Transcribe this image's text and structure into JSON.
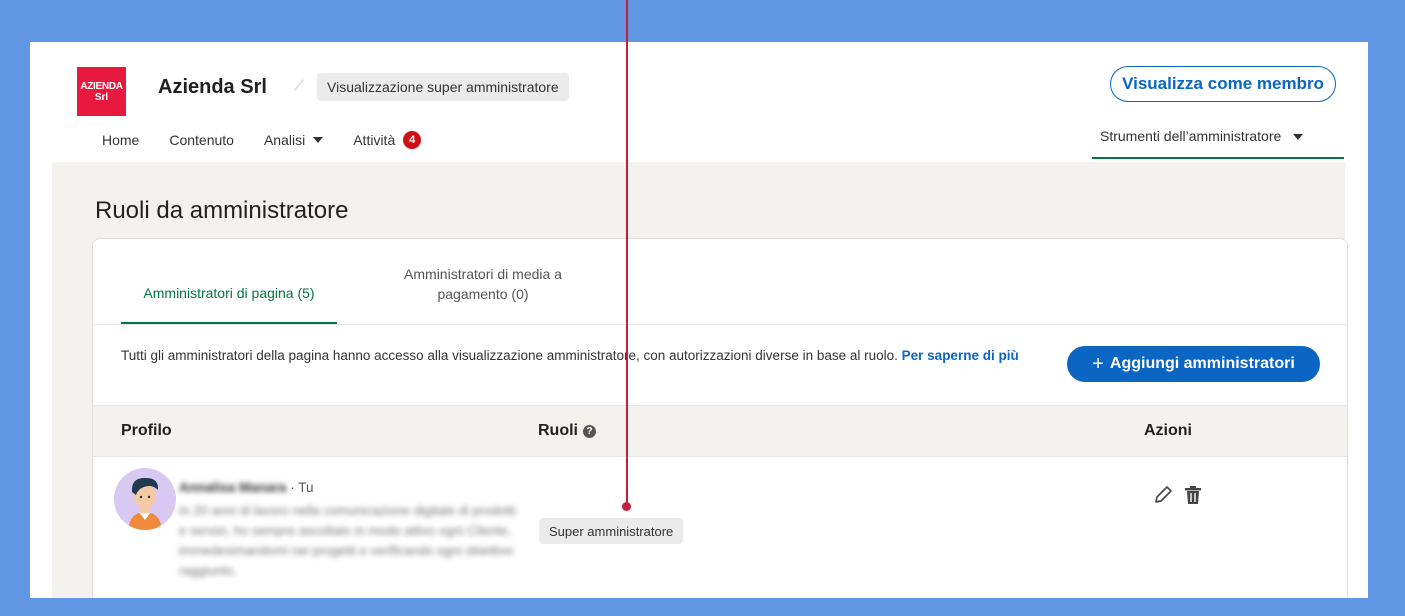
{
  "app": {
    "logo": {
      "line1": "AZIENDA",
      "line2": "Srl"
    },
    "company_name": "Azienda Srl",
    "view_badge": "Visualizzazione super amministratore",
    "view_as_member": "Visualizza come membro"
  },
  "nav": {
    "items": [
      {
        "label": "Home"
      },
      {
        "label": "Contenuto"
      },
      {
        "label": "Analisi"
      },
      {
        "label": "Attività",
        "badge": "4"
      }
    ],
    "admin_tools": "Strumenti dell’amministratore"
  },
  "page": {
    "title": "Ruoli da amministratore",
    "tabs": [
      {
        "label": "Amministratori di pagina (5)",
        "active": true
      },
      {
        "label": "Amministratori di media a pagamento (0)",
        "active": false
      }
    ],
    "info_text": "Tutti gli amministratori della pagina hanno accesso alla visualizzazione amministratore, con autorizzazioni diverse in base al ruolo.",
    "info_link": "Per saperne di più",
    "add_button": "Aggiungi amministratori"
  },
  "table": {
    "headers": {
      "profile": "Profilo",
      "roles": "Ruoli",
      "actions": "Azioni"
    },
    "rows": [
      {
        "name": "Annalisa Manara",
        "suffix": "· Tu",
        "description": "In 20 anni di lavoro nella comunicazione digitale di prodotti e servizi, ho sempre ascoltato in modo attivo ogni Cliente, immedesimandomi nei progetti e verificando ogni obiettivo raggiunto.",
        "role": "Super amministratore"
      }
    ]
  },
  "colors": {
    "brand_blue": "#0a66c2",
    "active_green": "#057642",
    "logo_red": "#e8193f",
    "pointer": "#c5203b",
    "frame_bg": "#6196e3"
  }
}
